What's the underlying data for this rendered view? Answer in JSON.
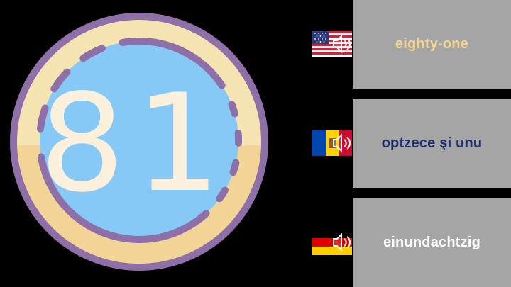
{
  "number": {
    "digits": "81"
  },
  "colors": {
    "background": "#000000",
    "ring_outer": "#8e6fa7",
    "ring_fill": "#f6e3b2",
    "ring_shade": "#f2d496",
    "face": "#86c9f6",
    "digit_fill": "#faf0dc",
    "card": "#a5a5a5"
  },
  "translations": [
    {
      "language": "English",
      "flag_icon": "us-flag-speaker-icon",
      "word": "eighty-one",
      "text_color": "#f3d48f"
    },
    {
      "language": "Romanian",
      "flag_icon": "moldova-flag-speaker-icon",
      "word": "optzece şi unu",
      "text_color": "#1d2f6f"
    },
    {
      "language": "German",
      "flag_icon": "germany-flag-speaker-icon",
      "word": "einundachtzig",
      "text_color": "#ffffff"
    }
  ]
}
